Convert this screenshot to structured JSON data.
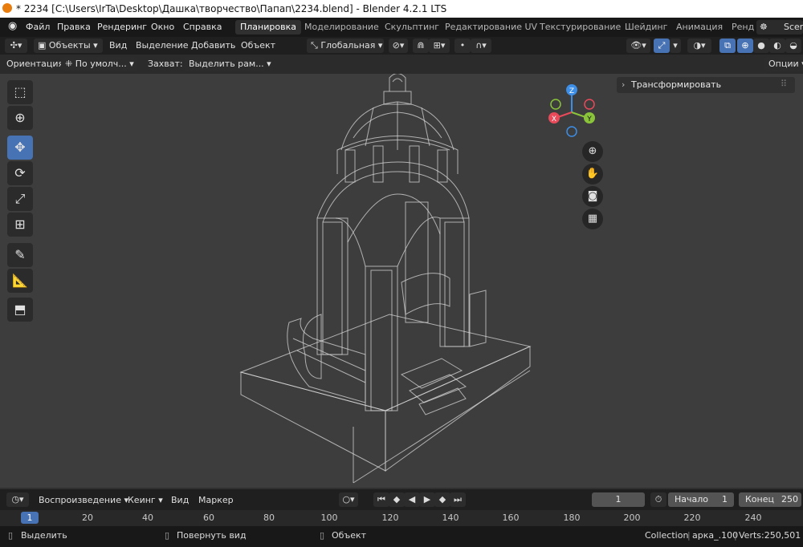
{
  "window": {
    "title": "* 2234 [C:\\Users\\IrTa\\Desktop\\Дашка\\творчество\\Папап\\2234.blend] - Blender 4.2.1 LTS"
  },
  "menu": [
    "Файл",
    "Правка",
    "Рендеринг",
    "Окно",
    "Справка"
  ],
  "workspaces": [
    "Планировка",
    "Моделирование",
    "Скульптинг",
    "Редактирование UV",
    "Текстурирование",
    "Шейдинг",
    "Анимация",
    "Ренд"
  ],
  "active_workspace": "Планировка",
  "scene_label": "Scen",
  "header": {
    "mode": "Объекты",
    "menus": [
      "Вид",
      "Выделение",
      "Добавить",
      "Объект"
    ],
    "transform_orientation": "Глобальная"
  },
  "toolsettings": {
    "orientation_label": "Ориентация:",
    "orientation_value": "По умолч...",
    "snap_label": "Захват:",
    "snap_value": "Выделить рам...",
    "options_label": "Опции"
  },
  "sidebar_panel": {
    "title": "Трансформировать"
  },
  "gizmo": {
    "z": "Z",
    "x": "X",
    "y": "Y"
  },
  "timeline": {
    "menus": [
      "Воспроизведение",
      "Кеинг",
      "Вид",
      "Маркер"
    ],
    "current_frame": "1",
    "start_label": "Начало",
    "start_value": "1",
    "end_label": "Конец",
    "end_value": "250",
    "ruler_ticks": [
      "1",
      "20",
      "40",
      "60",
      "80",
      "100",
      "120",
      "140",
      "160",
      "180",
      "200",
      "220",
      "240"
    ]
  },
  "status": {
    "select": "Выделить",
    "rotate": "Повернуть вид",
    "object": "Объект",
    "collection": "Collection",
    "object_name": "арка_.100",
    "verts": "Verts:250,501"
  },
  "colors": {
    "accent": "#4772b3",
    "x_axis": "#e94a5a",
    "y_axis": "#8ac43a",
    "z_axis": "#3d8ee6"
  }
}
